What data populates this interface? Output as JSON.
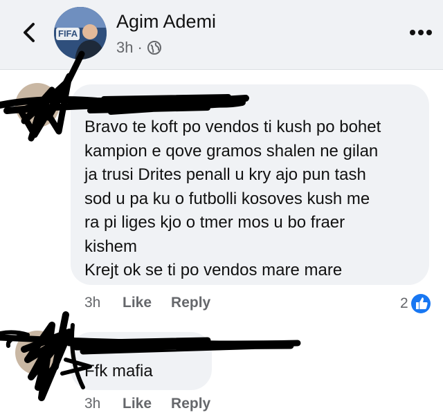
{
  "header": {
    "name": "Agim Ademi",
    "time": "3h",
    "dot": "·",
    "avatar_label": "FIFA",
    "icons": {
      "back": "chevron-left-icon",
      "privacy": "globe-icon",
      "more": "more-horizontal-icon"
    }
  },
  "comments": [
    {
      "text": "Bravo te koft po vendos ti kush po bohet\nkampion e qove gramos shalen ne gilan\nja trusi Drites penall u kry ajo pun tash\nsod u pa ku o futbolli kosoves kush me\nra pi liges kjo o tmer mos u bo fraer\nkishem\nKrejt ok se ti po vendos mare mare",
      "time": "3h",
      "like_label": "Like",
      "reply_label": "Reply",
      "reaction_count": "2",
      "reaction_icon": "thumbs-up-icon"
    },
    {
      "text": "Ffk mafia",
      "time": "3h",
      "like_label": "Like",
      "reply_label": "Reply"
    }
  ],
  "colors": {
    "header_bg": "#f0f2f5",
    "bubble_bg": "#f0f2f5",
    "meta_text": "#65676b",
    "like_blue": "#1877f2"
  }
}
